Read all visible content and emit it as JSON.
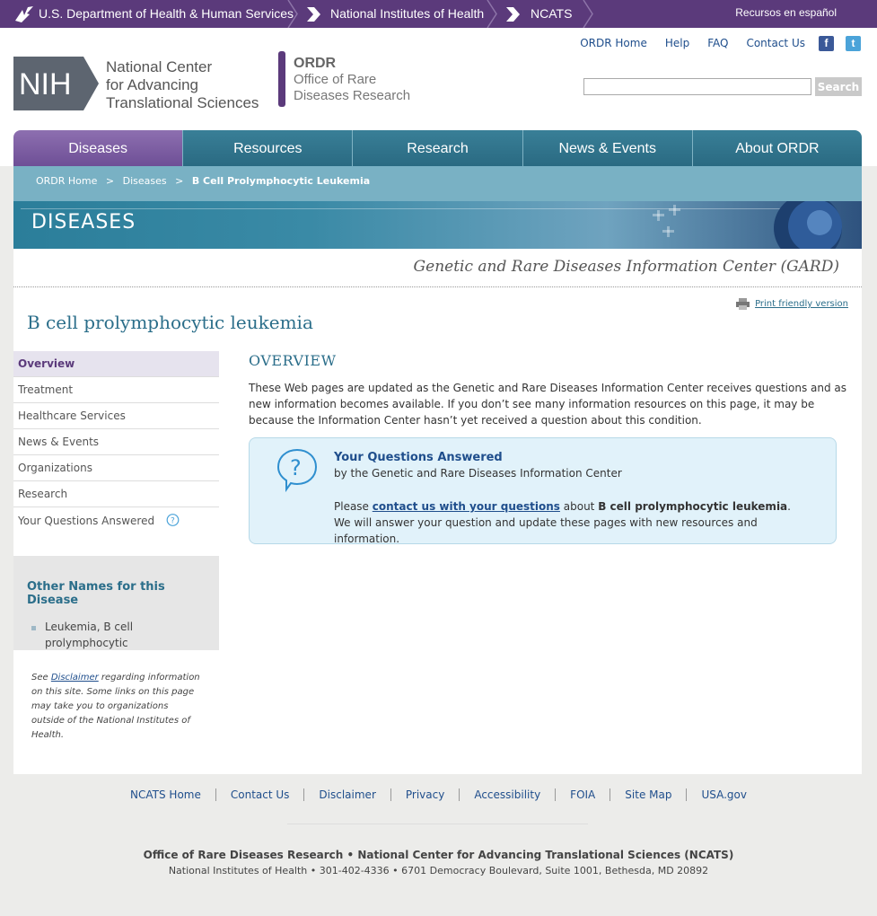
{
  "hhs_bar": {
    "hhs": "U.S. Department of Health & Human Services",
    "nih": "National Institutes of Health",
    "ncats": "NCATS",
    "espanol": "Recursos en español"
  },
  "header": {
    "logo_text": "NIH",
    "ncats_name": [
      "National Center",
      "for Advancing",
      "Translational Sciences"
    ],
    "ordr_abbr": "ORDR",
    "ordr_line1": "Office of Rare",
    "ordr_line2": "Diseases Research",
    "util_links": [
      "ORDR Home",
      "Help",
      "FAQ",
      "Contact Us"
    ],
    "search_button": "Search",
    "search_placeholder": ""
  },
  "nav": {
    "items": [
      "Diseases",
      "Resources",
      "Research",
      "News & Events",
      "About ORDR"
    ],
    "active": "Diseases"
  },
  "breadcrumb": {
    "items": [
      "ORDR Home",
      "Diseases"
    ],
    "separator": ">",
    "current": "B Cell Prolymphocytic Leukemia"
  },
  "banner": {
    "title": "DISEASES"
  },
  "content": {
    "gard_title": "Genetic and Rare Diseases Information Center (GARD)",
    "print": "Print friendly version",
    "page_title": "B cell prolymphocytic leukemia",
    "left_nav": [
      "Overview",
      "Treatment",
      "Healthcare Services",
      "News & Events",
      "Organizations",
      "Research",
      "Your Questions Answered"
    ],
    "other_names_title": "Other Names for this Disease",
    "other_names": [
      "Leukemia, B cell prolymphocytic"
    ],
    "disclaimer_pre": "See ",
    "disclaimer_link": "Disclaimer",
    "disclaimer_post": " regarding information on this site. Some links on this page may take you to organizations outside of the National Institutes of Health.",
    "overview_title": "OVERVIEW",
    "overview_text": "These Web pages are updated as the Genetic and Rare Diseases Information Center receives questions and as new information becomes available. If you don’t see many information resources on this page, it may be because the Information Center hasn’t yet received a question about this condition.",
    "qa_title": "Your Questions Answered",
    "qa_sub": "by the Genetic and Rare Diseases Information Center",
    "qa_please": "Please ",
    "qa_link": "contact us with your questions",
    "qa_about": " about ",
    "qa_disease": "B cell prolymphocytic leukemia",
    "qa_end": ". We will answer your question and update these pages with new resources and information."
  },
  "footer": {
    "links": [
      "NCATS Home",
      "Contact Us",
      "Disclaimer",
      "Privacy",
      "Accessibility",
      "FOIA",
      "Site Map",
      "USA.gov"
    ],
    "org": "Office of Rare Diseases Research • National Center for Advancing Translational Sciences (NCATS)",
    "address": "National Institutes of Health • 301-402-4336 • 6701 Democracy Boulevard, Suite 1001, Bethesda, MD 20892"
  },
  "colors": {
    "purple": "#5b3a7b",
    "teal": "#2b6e8a",
    "link": "#1f4e8c"
  }
}
